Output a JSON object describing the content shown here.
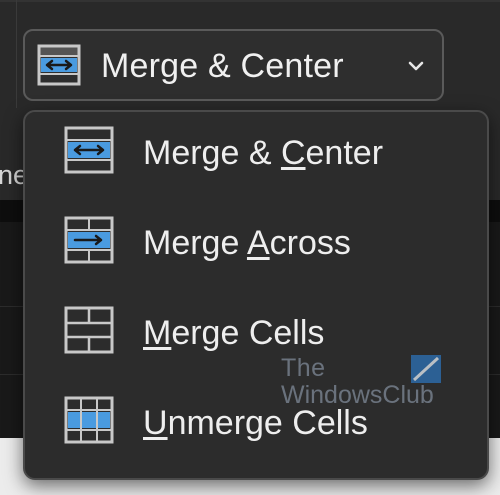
{
  "ribbon": {
    "clipped_label": "ne"
  },
  "merge_button": {
    "label": "Merge & Center",
    "icon": "merge-center-icon",
    "dropdown_icon": "chevron-down-icon"
  },
  "menu": {
    "items": [
      {
        "pre": "Merge & ",
        "accel": "C",
        "post": "enter",
        "icon": "merge-center-icon"
      },
      {
        "pre": "Merge ",
        "accel": "A",
        "post": "cross",
        "icon": "merge-across-icon"
      },
      {
        "pre": "",
        "accel": "M",
        "post": "erge Cells",
        "icon": "merge-cells-icon"
      },
      {
        "pre": "",
        "accel": "U",
        "post": "nmerge Cells",
        "icon": "unmerge-cells-icon"
      }
    ]
  },
  "watermark": {
    "line1": "The",
    "line2": "WindowsClub"
  },
  "colors": {
    "icon_blue": "#4a9be0",
    "icon_frame": "#c8c8c8",
    "menu_bg": "#2c2c2c",
    "ribbon_bg": "#292929"
  }
}
